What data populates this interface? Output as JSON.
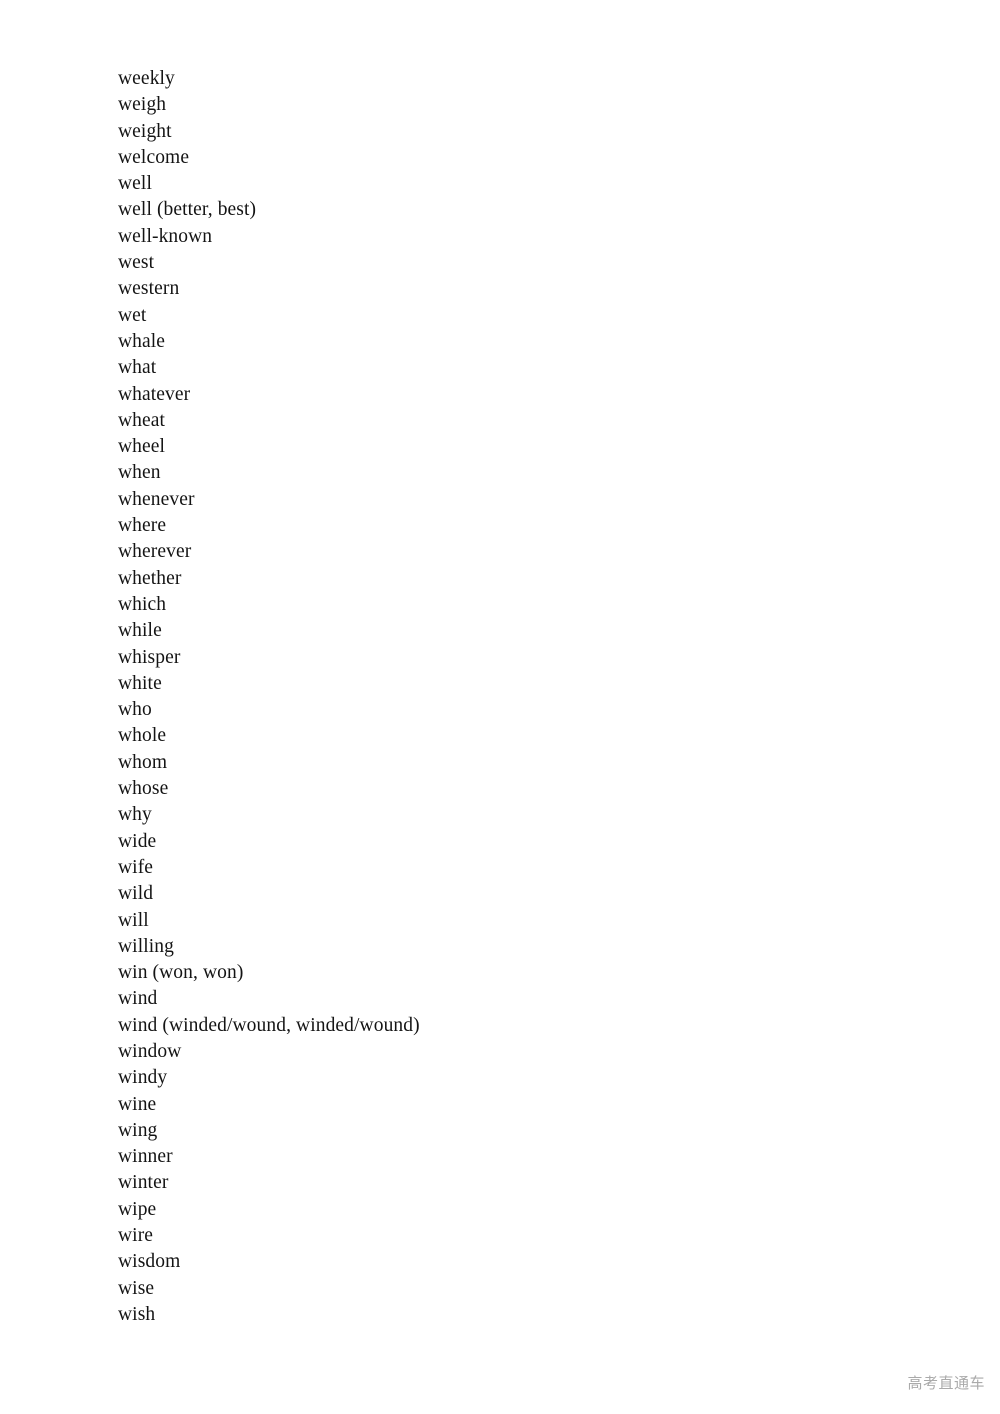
{
  "document": {
    "background_color": "#ffffff",
    "text_color": "#141414",
    "word_list": [
      "weekly",
      "weigh",
      "weight",
      "welcome",
      "well",
      "well (better, best)",
      "well-known",
      "west",
      "western",
      "wet",
      "whale",
      "what",
      "whatever",
      "wheat",
      "wheel",
      "when",
      "whenever",
      "where",
      "wherever",
      "whether",
      "which",
      "while",
      "whisper",
      "white",
      "who",
      "whole",
      "whom",
      "whose",
      "why",
      "wide",
      "wife",
      "wild",
      "will",
      "willing",
      "win (won, won)",
      "wind",
      "wind (winded/wound, winded/wound)",
      "window",
      "windy",
      "wine",
      "wing",
      "winner",
      "winter",
      "wipe",
      "wire",
      "wisdom",
      "wise",
      "wish"
    ]
  },
  "watermark": {
    "text": "高考直通车",
    "color": "#aaaaaa"
  }
}
